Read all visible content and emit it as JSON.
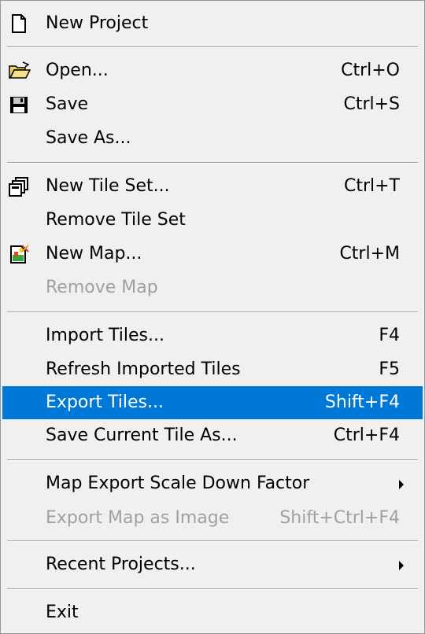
{
  "menu": {
    "new_project": {
      "label": "New Project",
      "icon": "new-document-icon"
    },
    "open": {
      "label": "Open...",
      "shortcut": "Ctrl+O",
      "icon": "open-folder-icon"
    },
    "save": {
      "label": "Save",
      "shortcut": "Ctrl+S",
      "icon": "floppy-disk-icon"
    },
    "save_as": {
      "label": "Save As..."
    },
    "new_tile_set": {
      "label": "New Tile Set...",
      "shortcut": "Ctrl+T",
      "icon": "tile-set-icon"
    },
    "remove_tile_set": {
      "label": "Remove Tile Set"
    },
    "new_map": {
      "label": "New Map...",
      "shortcut": "Ctrl+M",
      "icon": "new-map-icon"
    },
    "remove_map": {
      "label": "Remove Map",
      "disabled": true
    },
    "import_tiles": {
      "label": "Import Tiles...",
      "shortcut": "F4"
    },
    "refresh_imported_tiles": {
      "label": "Refresh Imported Tiles",
      "shortcut": "F5"
    },
    "export_tiles": {
      "label": "Export Tiles...",
      "shortcut": "Shift+F4",
      "selected": true
    },
    "save_current_tile_as": {
      "label": "Save Current Tile As...",
      "shortcut": "Ctrl+F4"
    },
    "map_export_scale_down_factor": {
      "label": "Map Export Scale Down Factor",
      "submenu": true
    },
    "export_map_as_image": {
      "label": "Export Map as Image",
      "shortcut": "Shift+Ctrl+F4",
      "disabled": true
    },
    "recent_projects": {
      "label": "Recent Projects...",
      "submenu": true
    },
    "exit": {
      "label": "Exit"
    }
  },
  "colors": {
    "menu_background": "#f0f0f0",
    "highlight": "#0078d7",
    "disabled_text": "#a0a0a0"
  }
}
